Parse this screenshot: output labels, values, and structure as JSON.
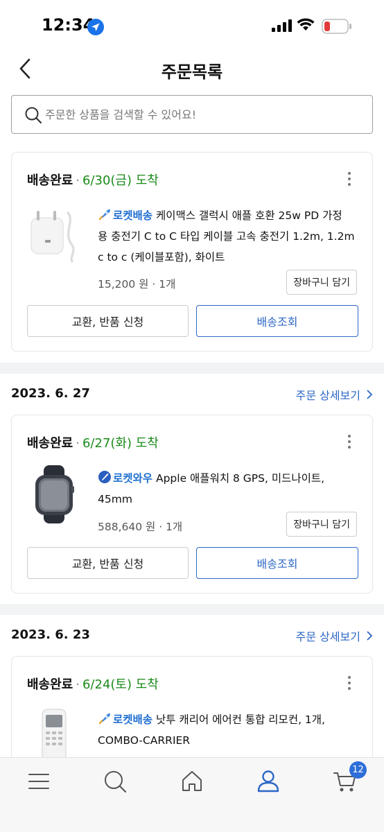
{
  "status_bar": {
    "time": "12:34"
  },
  "header": {
    "title": "주문목록"
  },
  "search": {
    "placeholder": "주문한 상품을 검색할 수 있어요!"
  },
  "orders": [
    {
      "status": "배송완료",
      "arrival": "6/30(금) 도착",
      "badge": "로켓배송",
      "product_name": "케이맥스 갤럭시 애플 호환 25w PD 가정용 충전기 C to C 타입 케이블 고속 충전기 1.2m, 1.2m c to c (케이블포함), 화이트",
      "name_lines": [
        "케이맥스 갤럭시 애플 호환 25w PD 가정",
        "용 충전기 C to C 타입 케이블 고속 충전기 1.2m, 1.2m",
        "c to c (케이블포함), 화이트"
      ],
      "price": "15,200 원 · 1개",
      "cart_label": "장바구니 담기",
      "exchange_label": "교환, 반품 신청",
      "track_label": "배송조회"
    },
    {
      "order_date": "2023. 6. 27",
      "detail_label": "주문 상세보기",
      "status": "배송완료",
      "arrival": "6/27(화) 도착",
      "badge": "로켓와우",
      "product_name": "Apple 애플워치 8 GPS, 미드나이트, 45mm",
      "name_lines": [
        "Apple 애플워치 8 GPS, 미드나이트,",
        "45mm"
      ],
      "price": "588,640 원 · 1개",
      "cart_label": "장바구니 담기",
      "exchange_label": "교환, 반품 신청",
      "track_label": "배송조회"
    },
    {
      "order_date": "2023. 6. 23",
      "detail_label": "주문 상세보기",
      "status": "배송완료",
      "arrival": "6/24(토) 도착",
      "badge": "로켓배송",
      "product_name": "낫투 캐리어 에어컨 통합 리모컨, 1개, COMBO-CARRIER",
      "name_lines": [
        "낫투 캐리어 에어컨 통합 리모컨, 1개,",
        "COMBO-CARRIER"
      ]
    }
  ],
  "tabbar": {
    "items": [
      "menu-icon",
      "search-icon",
      "home-icon",
      "user-icon",
      "cart-icon"
    ],
    "cart_count": "12"
  },
  "colors": {
    "accent": "#2c67c6",
    "arrival_green": "#1a8a1a",
    "badge_blue": "#2e6ed8"
  }
}
